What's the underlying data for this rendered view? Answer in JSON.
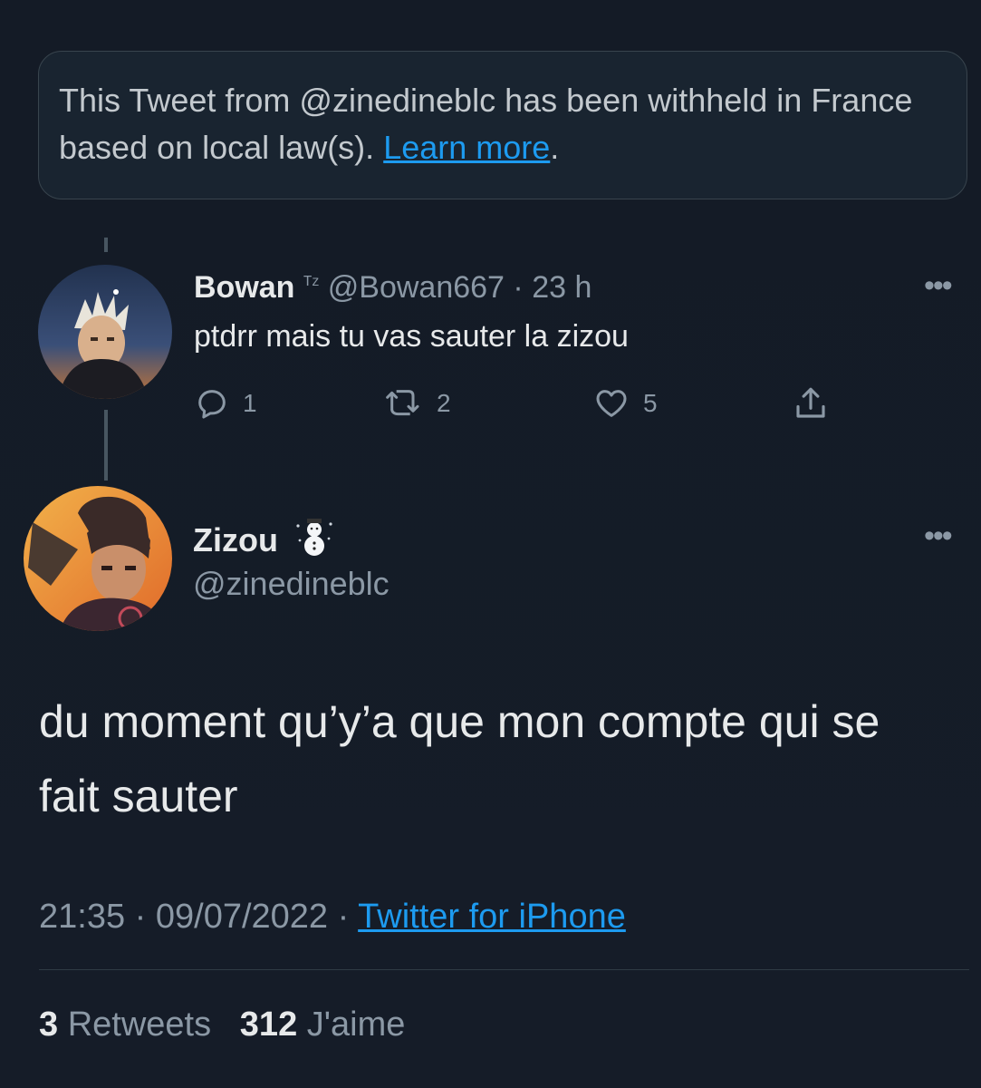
{
  "withheld_notice": {
    "text": "This Tweet from @zinedineblc has been withheld in France based on local law(s).",
    "link_label": "Learn more",
    "trailing": "."
  },
  "reply": {
    "display_name": "Bowan",
    "name_suffix": "ᵀᶻ",
    "handle": "@Bowan667",
    "separator": "·",
    "time": "23 h",
    "text": "ptdrr mais tu vas sauter la zizou",
    "reply_count": "1",
    "retweet_count": "2",
    "like_count": "5",
    "more_label": "•••"
  },
  "tweet": {
    "display_name": "Zizou",
    "badge_icon": "snowman-emoji",
    "handle": "@zinedineblc",
    "text": "du moment qu’y’a que mon compte qui se fait sauter",
    "time": "21:35",
    "separator1": "·",
    "date": "09/07/2022",
    "separator2": "·",
    "source": "Twitter for iPhone",
    "retweets_count": "3",
    "retweets_label": "Retweets",
    "likes_count": "312",
    "likes_label": "J'aime",
    "more_label": "•••"
  },
  "colors": {
    "background": "#15202b",
    "accent": "#1d9bf0",
    "muted": "#8b98a5",
    "text": "#e7e9ea"
  }
}
